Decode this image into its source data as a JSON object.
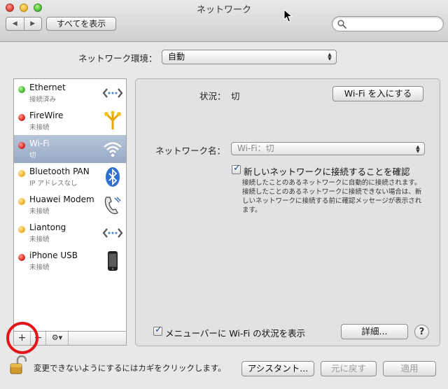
{
  "window": {
    "title": "ネットワーク",
    "nav_back": "◀",
    "nav_forward": "▶",
    "show_all": "すべてを表示"
  },
  "location": {
    "label": "ネットワーク環境：",
    "value": "自動"
  },
  "services": [
    {
      "name": "Ethernet",
      "status": "接続済み",
      "status_color": "green",
      "icon": "ethernet-icon"
    },
    {
      "name": "FireWire",
      "status": "未接続",
      "status_color": "red",
      "icon": "firewire-icon"
    },
    {
      "name": "Wi-Fi",
      "status": "切",
      "status_color": "red",
      "icon": "wifi-icon",
      "selected": true
    },
    {
      "name": "Bluetooth PAN",
      "status": "IP アドレスなし",
      "status_color": "yellow",
      "icon": "bluetooth-icon"
    },
    {
      "name": "Huawei Modem",
      "status": "未接続",
      "status_color": "yellow",
      "icon": "modem-phone-icon"
    },
    {
      "name": "Liantong",
      "status": "未接続",
      "status_color": "yellow",
      "icon": "ethernet-icon"
    },
    {
      "name": "iPhone USB",
      "status": "未接続",
      "status_color": "red",
      "icon": "iphone-icon"
    }
  ],
  "list_toolbar": {
    "add": "+",
    "remove": "−",
    "gear": "⚙▾"
  },
  "detail": {
    "status_label": "状況：",
    "status_value": "切",
    "wifi_on_button": "Wi-Fi を入にする",
    "network_name_label": "ネットワーク名：",
    "network_name_value": "Wi-Fi：切",
    "ask_checkbox_label": "新しいネットワークに接続することを確認",
    "ask_checked": true,
    "ask_description": "接続したことのあるネットワークに自動的に接続されます。接続したことのあるネットワークに接続できない場合は、新しいネットワークに接続する前に確認メッセージが表示されます。",
    "menubar_checkbox_label": "メニューバーに Wi-Fi の状況を表示",
    "menubar_checked": true,
    "advanced_button": "詳細...",
    "help_button": "?"
  },
  "bottom": {
    "lock_text": "変更できないようにするにはカギをクリックします。",
    "assistant_button": "アシスタント...",
    "revert_button": "元に戻す",
    "apply_button": "適用"
  },
  "colors": {
    "selection": "#9fb0c9",
    "status_green": "#3fb52a",
    "status_red": "#d8231c",
    "status_yellow": "#f0b020",
    "annotation_circle": "#e4161a"
  }
}
